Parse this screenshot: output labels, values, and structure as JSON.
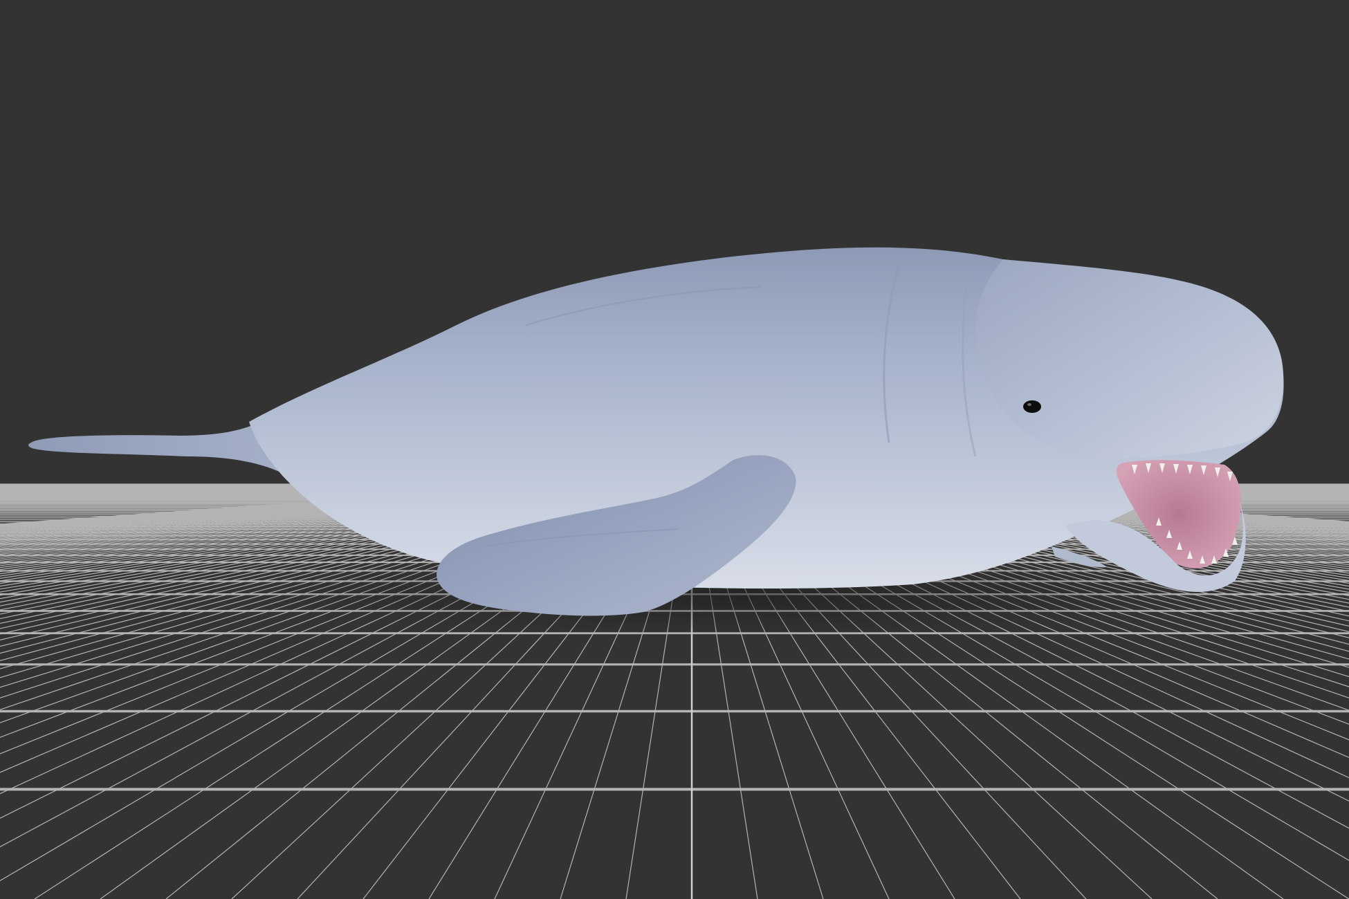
{
  "viewport": {
    "background_color": "#333333",
    "grid_floor": {
      "line_color": "#b4b4b4",
      "axis_color": "#cfcfcf",
      "visible": true
    },
    "model": {
      "subject": "beluga whale",
      "skin_color": "#a8b4cc",
      "belly_color": "#d4dae6",
      "mouth_color": "#c98ea6",
      "tooth_color": "#f2f0ea",
      "eye_color": "#0d0d0d"
    }
  }
}
